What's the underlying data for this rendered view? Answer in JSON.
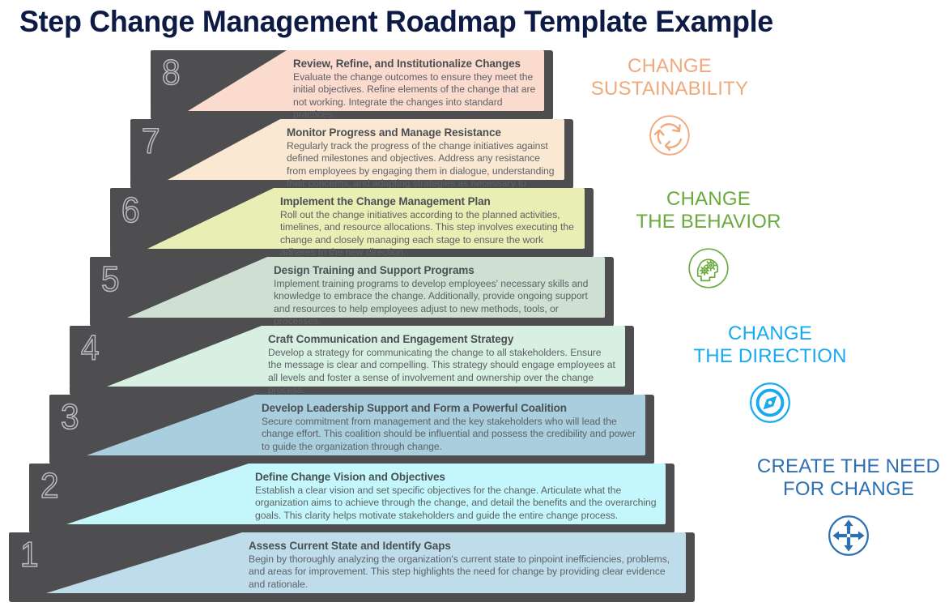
{
  "title": "Step Change Management Roadmap Template Example",
  "theme": {
    "title_color": "#0d1a46",
    "wedge_color": "#4e4e50",
    "number_outline_color": "#b9bbbd",
    "heading_color": "#4a4f53",
    "body_color": "#5d6266"
  },
  "steps": [
    {
      "number": "8",
      "heading": "Review, Refine, and Institutionalize Changes",
      "body": "Evaluate the change outcomes to ensure they meet the initial objectives. Refine elements of the change that are not working. Integrate the changes into standard practices.",
      "color": "#fadbcd"
    },
    {
      "number": "7",
      "heading": "Monitor Progress and Manage Resistance",
      "body": "Regularly track the progress of the change initiatives against defined milestones and objectives. Address any resistance from employees by engaging them in dialogue, understanding their concerns, and adapting strategies as necessary to maintain momentum.",
      "color": "#fbe8d2"
    },
    {
      "number": "6",
      "heading": "Implement the Change Management Plan",
      "body": "Roll out the change initiatives according to the planned activities, timelines, and resource allocations. This step involves executing the change and closely managing each stage to ensure the work adheres to the new direction.",
      "color": "#e9eeb4"
    },
    {
      "number": "5",
      "heading": "Design Training and Support Programs",
      "body": "Implement training programs to develop employees' necessary skills and knowledge to embrace the change. Additionally, provide ongoing support and resources to help employees adjust to new methods, tools, or processes.",
      "color": "#cfe0d2"
    },
    {
      "number": "4",
      "heading": "Craft Communication and Engagement Strategy",
      "body": "Develop a strategy for communicating the change to all stakeholders. Ensure the message is clear and compelling. This strategy should engage employees at all levels and foster a sense of involvement and ownership over the change process.",
      "color": "#d8f0e2"
    },
    {
      "number": "3",
      "heading": "Develop Leadership Support and Form a Powerful Coalition",
      "body": "Secure commitment from management and the key stakeholders who will lead the change effort. This coalition should be influential and possess the credibility and power to guide the organization through change.",
      "color": "#a9cedd"
    },
    {
      "number": "2",
      "heading": "Define Change Vision and Objectives",
      "body": "Establish a clear vision and set specific objectives for the change. Articulate what the organization aims to achieve through the change, and detail the benefits and the overarching goals. This clarity helps motivate stakeholders and guide the entire change process.",
      "color": "#c4f7fb"
    },
    {
      "number": "1",
      "heading": "Assess Current State and Identify Gaps",
      "body": "Begin by thoroughly analyzing the organization's current state to pinpoint inefficiencies, problems, and areas for improvement. This step highlights the need for change by providing clear evidence and rationale.",
      "color": "#bfdcea"
    }
  ],
  "milestones": [
    {
      "label": "CHANGE\nSUSTAINABILITY",
      "color": "#efa97c",
      "icon": "recycle-arrows-icon"
    },
    {
      "label": "CHANGE\nTHE BEHAVIOR",
      "color": "#6aaa3c",
      "icon": "head-gears-icon"
    },
    {
      "label": "CHANGE\nTHE DIRECTION",
      "color": "#18aaf0",
      "icon": "compass-icon"
    },
    {
      "label": "CREATE THE NEED\nFOR CHANGE",
      "color": "#2d6fb3",
      "icon": "four-arrows-icon"
    }
  ]
}
